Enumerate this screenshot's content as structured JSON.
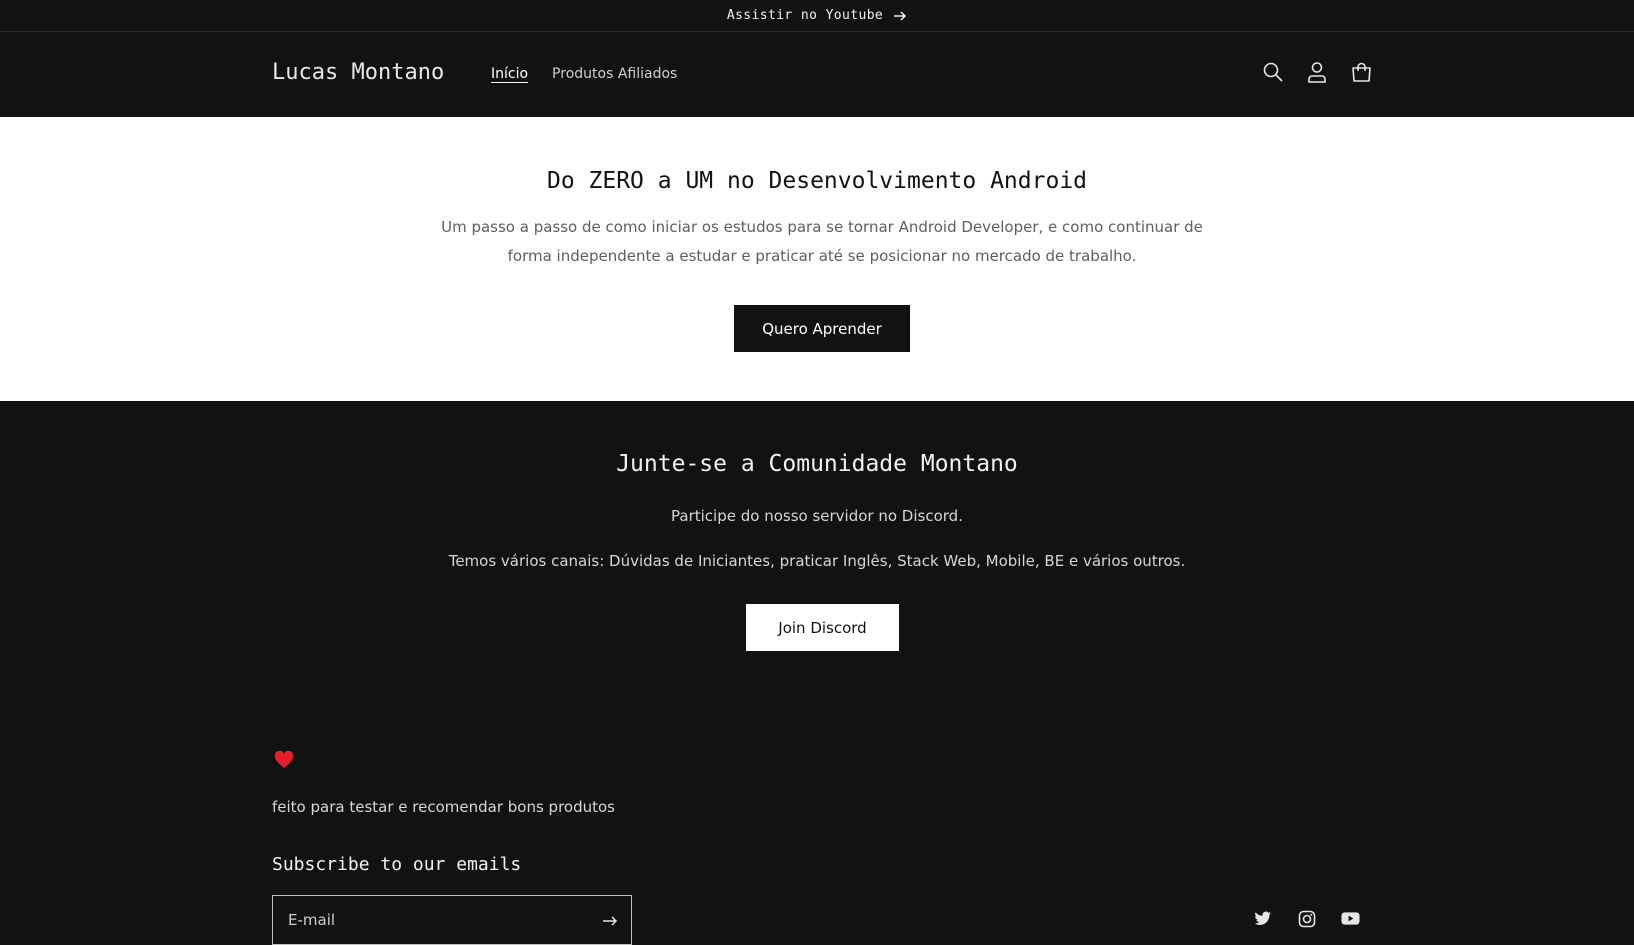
{
  "announcement": {
    "text": "Assistir no Youtube"
  },
  "header": {
    "logo": "Lucas Montano",
    "nav": [
      {
        "label": "Início",
        "active": true
      },
      {
        "label": "Produtos Afiliados",
        "active": false
      }
    ],
    "icons": [
      "search-icon",
      "account-icon",
      "cart-icon"
    ]
  },
  "hero": {
    "title": "Do ZERO a UM no Desenvolvimento Android",
    "description": "Um passo a passo de como iniciar os estudos para se tornar Android Developer, e como continuar de forma independente a estudar e praticar até se posicionar no mercado de trabalho.",
    "button": "Quero Aprender"
  },
  "community": {
    "title": "Junte-se a Comunidade Montano",
    "text1": "Participe do nosso servidor no Discord.",
    "text2": "Temos vários canais: Dúvidas de Iniciantes, praticar Inglês, Stack Web, Mobile, BE e vários outros.",
    "button": "Join Discord"
  },
  "footer": {
    "heart_icon": "heart-icon",
    "tagline": "feito para testar e recomendar bons produtos",
    "subscribe_title": "Subscribe to our emails",
    "email_placeholder": "E-mail",
    "social_icons": [
      "twitter-icon",
      "instagram-icon",
      "youtube-icon"
    ]
  },
  "colors": {
    "dark": "#121212",
    "light": "#ffffff",
    "heart": "#e3202a"
  }
}
